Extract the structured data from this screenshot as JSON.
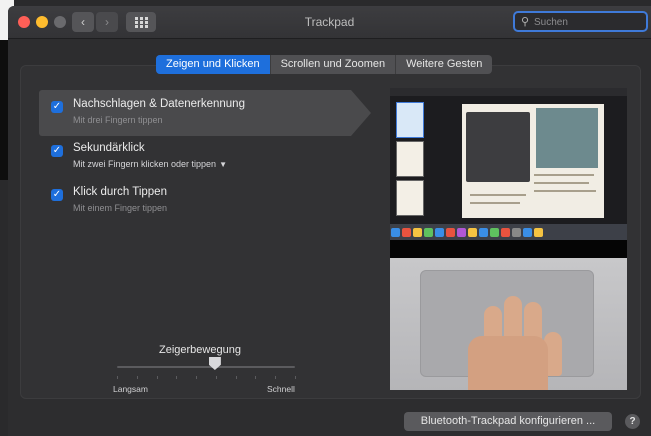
{
  "window": {
    "title": "Trackpad"
  },
  "toolbar": {
    "back_glyph": "‹",
    "forward_glyph": "›",
    "search_placeholder": "Suchen",
    "search_icon": "magnifier-icon",
    "grid_icon": "show-all-grid-icon"
  },
  "tabs": [
    {
      "label": "Zeigen und Klicken",
      "active": true
    },
    {
      "label": "Scrollen und Zoomen",
      "active": false
    },
    {
      "label": "Weitere Gesten",
      "active": false
    }
  ],
  "options": [
    {
      "title": "Nachschlagen & Datenerkennung",
      "subtitle": "Mit drei Fingern tippen",
      "checked": true,
      "selected": true
    },
    {
      "title": "Sekundärklick",
      "subtitle": "Mit zwei Fingern klicken oder tippen",
      "checked": true,
      "selected": false,
      "has_menu": true
    },
    {
      "title": "Klick durch Tippen",
      "subtitle": "Mit einem Finger tippen",
      "checked": true,
      "selected": false
    }
  ],
  "pointer_speed": {
    "title": "Zeigerbewegung",
    "min_label": "Langsam",
    "max_label": "Schnell",
    "value_fraction": 0.55
  },
  "footer": {
    "bluetooth_button": "Bluetooth-Trackpad konfigurieren ...",
    "help_button": "?"
  },
  "colors": {
    "accent": "#1e6fdc",
    "close": "#fe5f57",
    "minimize": "#febc2e"
  }
}
